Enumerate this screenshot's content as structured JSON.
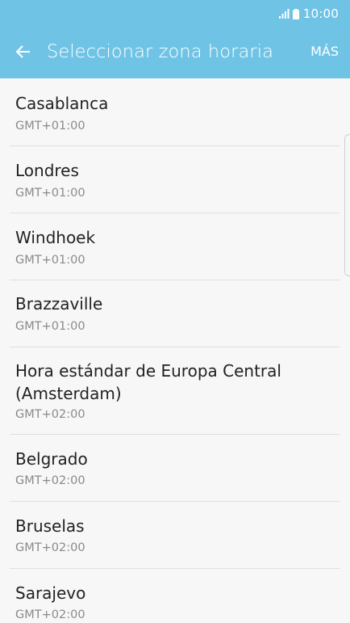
{
  "status_bar": {
    "time": "10:00",
    "icons": [
      "signal-icon",
      "battery-icon"
    ]
  },
  "header": {
    "back_icon": "arrow-left-icon",
    "title": "Seleccionar zona horaria",
    "more_label": "MÁS"
  },
  "colors": {
    "header_bg": "#6fc4e6",
    "list_bg": "#f7f7f7",
    "name_text": "#222222",
    "offset_text": "#8a8a8a"
  },
  "timezones": [
    {
      "name": "Casablanca",
      "offset": "GMT+01:00"
    },
    {
      "name": "Londres",
      "offset": "GMT+01:00"
    },
    {
      "name": "Windhoek",
      "offset": "GMT+01:00"
    },
    {
      "name": "Brazzaville",
      "offset": "GMT+01:00"
    },
    {
      "name": "Hora estándar de Europa Central",
      "name_line2": "(Amsterdam)",
      "offset": "GMT+02:00"
    },
    {
      "name": "Belgrado",
      "offset": "GMT+02:00"
    },
    {
      "name": "Bruselas",
      "offset": "GMT+02:00"
    },
    {
      "name": "Sarajevo",
      "offset": "GMT+02:00"
    }
  ]
}
